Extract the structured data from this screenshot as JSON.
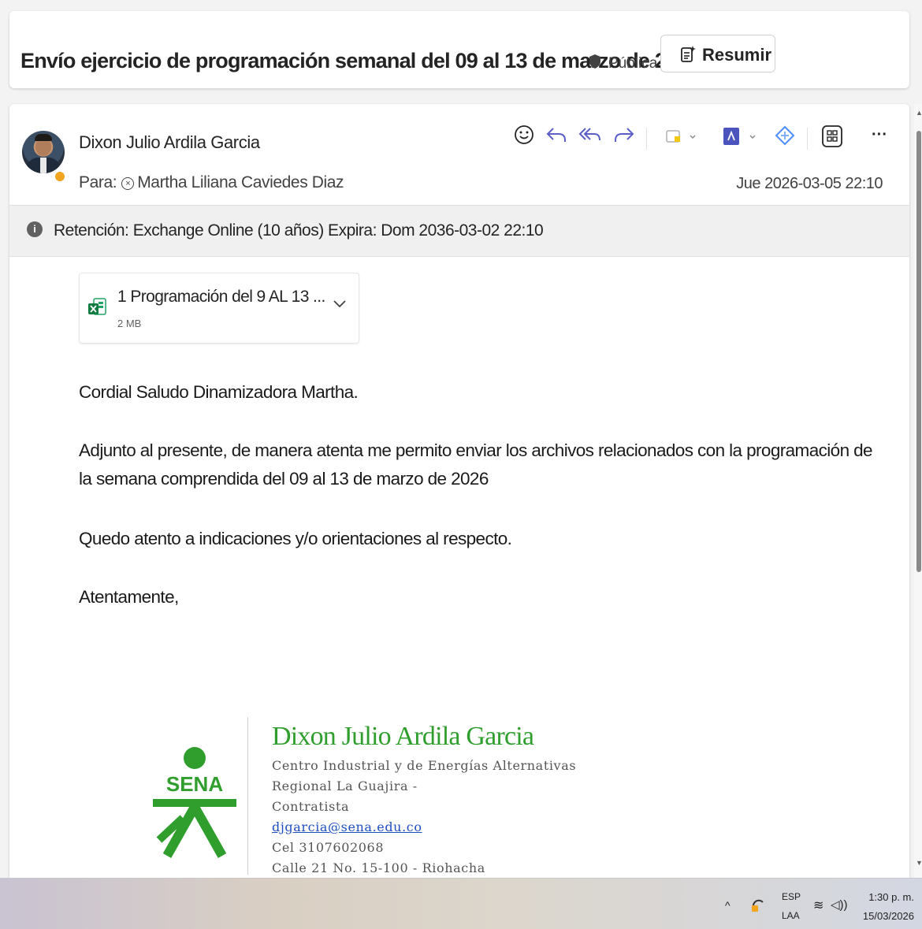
{
  "subject": {
    "text": "Envío ejercicio de programación semanal del 09 al 13 de marzo de 2026.",
    "sensitivity_label": "Pública",
    "summarize_label": "Resumir"
  },
  "message": {
    "sender": "Dixon Julio Ardila Garcia",
    "to_prefix": "Para:",
    "to_recipient": "Martha Liliana Caviedes Diaz",
    "date": "Jue 2026-03-05 22:10",
    "toolbar_icons": [
      "emoji-icon",
      "reply-icon",
      "reply-all-icon",
      "forward-icon",
      "apps-icon",
      "pdf-icon",
      "link-icon",
      "grid-icon",
      "more-icon"
    ],
    "more_label": "···",
    "retention": "Retención: Exchange Online (10 años) Expira: Dom 2036-03-02 22:10",
    "info_glyph": "i"
  },
  "attachment": {
    "name": "1 Programación del 9 AL 13 ...",
    "size": "2 MB"
  },
  "body": {
    "greeting": "Cordial Saludo Dinamizadora Martha.",
    "paragraph1": "Adjunto al presente, de manera atenta me permito enviar los archivos relacionados con la programación de la semana comprendida del 09 al 13 de marzo de 2026",
    "paragraph2": "Quedo atento a indicaciones y/o orientaciones al respecto.",
    "closing": "Atentamente,"
  },
  "signature": {
    "logo_text": "SENA",
    "name": "Dixon Julio Ardila Garcia",
    "line1": "Centro Industrial y de Energías Alternativas",
    "line2": "Regional La Guajira -",
    "line3": "Contratista",
    "email": "djgarcia@sena.edu.co",
    "phone": "Cel 3107602068",
    "address": "Calle 21 No. 15-100 - Riohacha",
    "accent_color": "#2f9e2c"
  },
  "taskbar": {
    "lang_top": "ESP",
    "lang_bottom": "LAA",
    "time": "1:30 p. m.",
    "date": "15/03/2026"
  }
}
